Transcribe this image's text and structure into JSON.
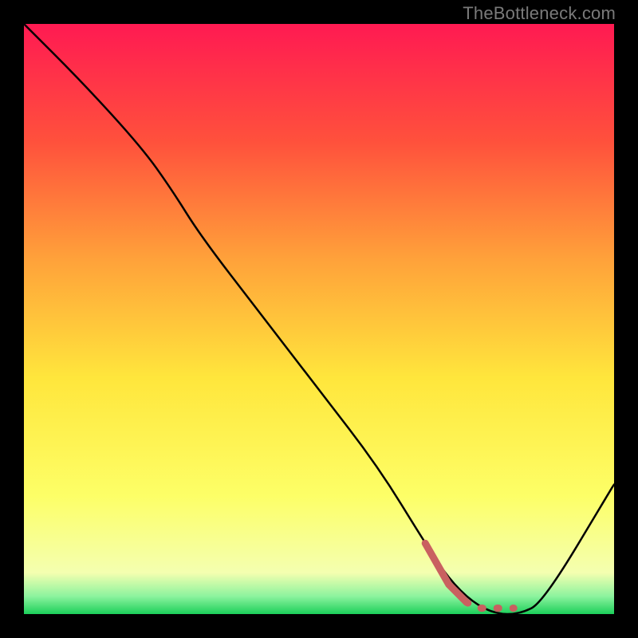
{
  "watermark": "TheBottleneck.com",
  "chart_data": {
    "type": "line",
    "title": "",
    "xlabel": "",
    "ylabel": "",
    "xlim": [
      0,
      100
    ],
    "ylim": [
      0,
      100
    ],
    "grid": false,
    "legend": false,
    "background_gradient": {
      "stops": [
        {
          "pos": 0.0,
          "color": "#ff1a52"
        },
        {
          "pos": 0.2,
          "color": "#ff513c"
        },
        {
          "pos": 0.4,
          "color": "#ffa23a"
        },
        {
          "pos": 0.6,
          "color": "#ffe63c"
        },
        {
          "pos": 0.8,
          "color": "#fdff67"
        },
        {
          "pos": 0.93,
          "color": "#f4ffb0"
        },
        {
          "pos": 0.97,
          "color": "#8cf39e"
        },
        {
          "pos": 1.0,
          "color": "#1ccf5a"
        }
      ]
    },
    "series": [
      {
        "name": "bottleneck-curve",
        "stroke": "#000000",
        "width": 2.5,
        "x": [
          0,
          10,
          20,
          25,
          30,
          40,
          50,
          60,
          68,
          72,
          76,
          80,
          84,
          88,
          100
        ],
        "y": [
          100,
          90,
          79,
          72,
          64,
          51,
          38,
          25,
          12,
          6,
          2,
          0,
          0,
          2,
          22
        ]
      },
      {
        "name": "recommended-range",
        "stroke": "#c96060",
        "width": 9,
        "dash": "solid-then-dashed",
        "x": [
          68,
          72,
          75,
          77,
          79,
          81,
          83
        ],
        "y": [
          12,
          5,
          2,
          1,
          1,
          1,
          1
        ]
      }
    ]
  }
}
